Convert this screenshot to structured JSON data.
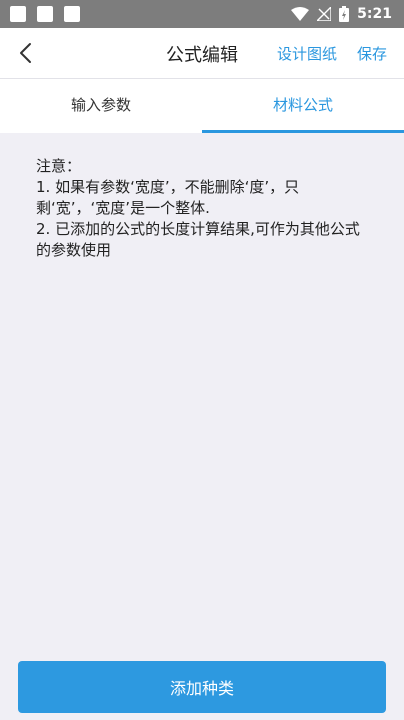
{
  "status_bar": {
    "time": "5:21"
  },
  "header": {
    "title": "公式编辑",
    "design_drawing": "设计图纸",
    "save": "保存"
  },
  "tabs": [
    {
      "label": "输入参数",
      "active": false
    },
    {
      "label": "材料公式",
      "active": true
    }
  ],
  "notes": {
    "heading": "注意：",
    "line1": "1. 如果有参数‘宽度’，不能删除‘度’，只剩‘宽’，‘宽度’是一个整体.",
    "line2": "2. 已添加的公式的长度计算结果,可作为其他公式的参数使用"
  },
  "footer": {
    "add_button": "添加种类"
  },
  "colors": {
    "accent": "#2a97df",
    "status_bar": "#7d7d7d",
    "background": "#f0eff5"
  }
}
